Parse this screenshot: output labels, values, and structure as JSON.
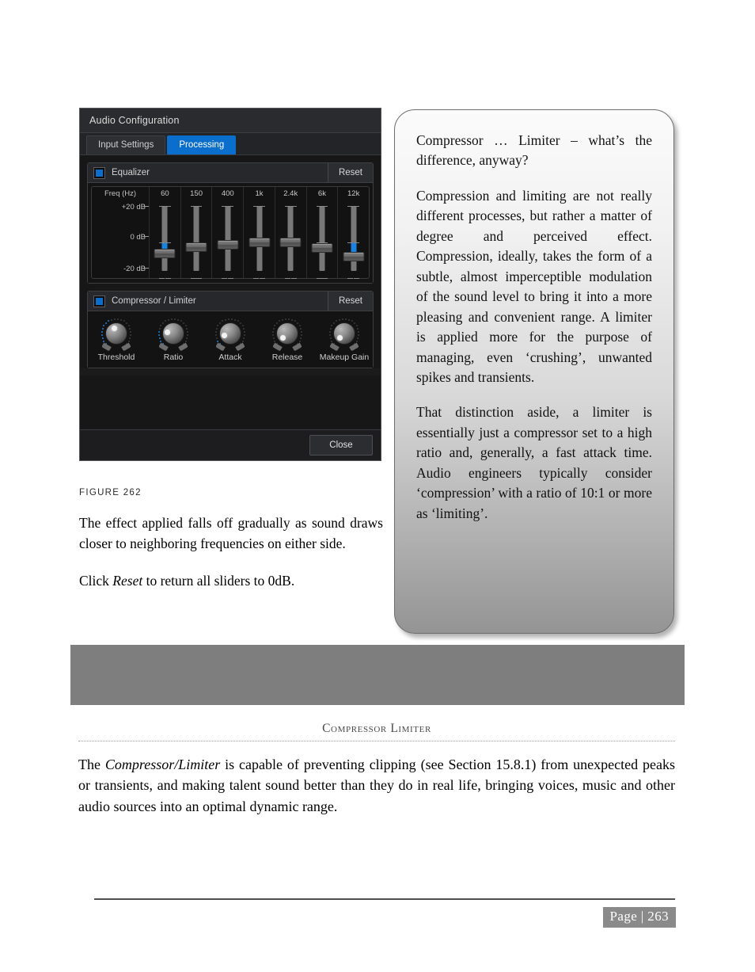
{
  "window": {
    "title": "Audio Configuration",
    "tabs": [
      {
        "label": "Input Settings",
        "active": false
      },
      {
        "label": "Processing",
        "active": true
      }
    ],
    "close_label": "Close",
    "accent_color": "#0a6ecc",
    "equalizer": {
      "title": "Equalizer",
      "reset_label": "Reset",
      "freq_header": "Freq (Hz)",
      "axis_labels": [
        "+20 dB",
        "0 dB",
        "-20 dB"
      ],
      "bands": [
        {
          "name": "60",
          "value_db": -6.5
        },
        {
          "name": "150",
          "value_db": -3.0
        },
        {
          "name": "400",
          "value_db": -1.5
        },
        {
          "name": "1k",
          "value_db": 0.0
        },
        {
          "name": "2.4k",
          "value_db": 0.0
        },
        {
          "name": "6k",
          "value_db": -3.5
        },
        {
          "name": "12k",
          "value_db": -8.0
        }
      ]
    },
    "compressor": {
      "title": "Compressor / Limiter",
      "reset_label": "Reset",
      "knobs": [
        {
          "label": "Threshold",
          "arc": 0.42
        },
        {
          "label": "Ratio",
          "arc": 0.22
        },
        {
          "label": "Attack",
          "arc": 0.1
        },
        {
          "label": "Release",
          "arc": 0.0
        },
        {
          "label": "Makeup Gain",
          "arc": 0.0
        }
      ]
    }
  },
  "figure": {
    "caption": "FIGURE 262"
  },
  "left_column": {
    "paragraph_1": "The effect applied falls off gradually as sound draws closer to neighboring frequencies on either side.",
    "paragraph_2_prefix": "Click ",
    "paragraph_2_italic": "Reset",
    "paragraph_2_suffix": " to return all sliders to 0dB."
  },
  "callout": {
    "paragraphs": [
      "Compressor … Limiter – what’s the difference, anyway?",
      "Compression and limiting are not really different processes, but rather a matter of degree and perceived effect. Compression, ideally, takes the form of a subtle, almost imperceptible modulation of the sound level to bring it into a more pleasing and convenient range.  A limiter is applied more for the purpose of managing, even ‘crushing’, unwanted spikes and transients.",
      "That distinction aside, a limiter is essentially just a compressor set to a high ratio and, generally, a fast attack time. Audio engineers typically consider ‘compression’ with a ratio of 10:1 or more as ‘limiting’."
    ]
  },
  "section": {
    "heading": "Compressor Limiter",
    "body_prefix": "The ",
    "body_italic": "Compressor/Limiter",
    "body_suffix": " is capable of preventing clipping (see Section 15.8.1) from unexpected peaks or transients, and making talent sound better than they do in real life, bringing voices, music and other audio sources into an optimal dynamic range."
  },
  "footer": {
    "page_label": "Page | 263"
  }
}
